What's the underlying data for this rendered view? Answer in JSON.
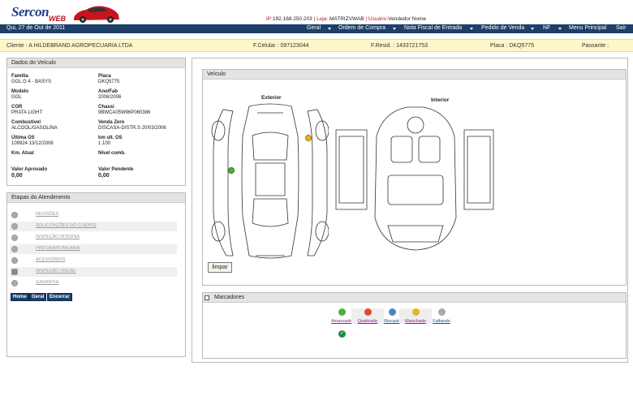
{
  "app": {
    "logo": "Sercon",
    "logo_sub": "WEB"
  },
  "topinfo": {
    "ip_label": "IP:",
    "ip": "192.168.250.203",
    "loja_label": "Loja:",
    "loja": "MATRIZVWAB",
    "usuario_label": "Usuário:",
    "usuario": "Vendedor Nome"
  },
  "nav": {
    "date": "Qui, 27 de Out de 2011",
    "items": [
      "Geral",
      "Ordem de Compra",
      "Nota Fiscal de Entrada",
      "Pedido de Venda",
      "NF",
      "Menu Principal",
      "Sair"
    ]
  },
  "client": {
    "cliente": "Cliente : A HILDEBRAND AGROPECUARIA LTDA",
    "celular": "F.Celular : 097123044",
    "resid": "F.Resid. : 1433721753",
    "placa": "Placa : DKQ5775",
    "passante": "Passante :"
  },
  "dados": {
    "title": "Dados do Veículo",
    "familia_l": "Família",
    "familia": "GOL G 4 - BASYS",
    "placa_l": "Placa",
    "placa": "DKQ5775",
    "modelo_l": "Modelo",
    "modelo": "GOL",
    "anofab_l": "Ano/Fab",
    "anofab": "2006/2006",
    "cor_l": "COR",
    "cor": "PRATA LIGHT",
    "chassi_l": "Chassi",
    "chassi": "9BWCA05W96P060386",
    "comb_l": "Combustível",
    "comb": "ALCOOL/GASOLINA",
    "vz_l": "Venda Zero",
    "vz": "DISCASA-DISTR.S 20/03/2006",
    "ultos_l": "Última OS",
    "ultos": "109924 13/12/2006",
    "kmult_l": "km ult. OS",
    "kmult": "1.100",
    "kmatual_l": "Km. Atual",
    "nivel_l": "Nível comb.",
    "vaprov_l": "Valor Aprovado",
    "vaprov": "0,00",
    "vpend_l": "Valor Pendente",
    "vpend": "0,00"
  },
  "etapas": {
    "title": "Etapas do Atendimento",
    "items": [
      "REVISÕES",
      "SOLICITAÇÕES DO CLIENTE",
      "INSPEÇÃO INTERNA",
      "PINTURA/FUNILARIA",
      "ACESSÓRIOS",
      "INSPEÇÃO VISUAL",
      "GARANTIA"
    ],
    "buttons": [
      "Home",
      "Geral",
      "Encerrar"
    ]
  },
  "veiculo": {
    "title": "Veículo",
    "exterior": "Exterior",
    "interior": "Interior",
    "limpar": "limpar"
  },
  "marcadores": {
    "title": "Marcadores",
    "items": [
      {
        "label": "Amassado",
        "color": "#4caf3a",
        "text_color": "#8a1f8a"
      },
      {
        "label": "Quebrado",
        "color": "#e64a2e",
        "text_color": "#8a1f8a"
      },
      {
        "label": "Riscado",
        "color": "#4a86c8",
        "text_color": "#1d4a9a"
      },
      {
        "label": "Manchado",
        "color": "#e8b420",
        "text_color": "#8a1f8a"
      },
      {
        "label": "Faltando",
        "color": "#aaaaaa",
        "text_color": "#1d4a9a"
      }
    ]
  }
}
